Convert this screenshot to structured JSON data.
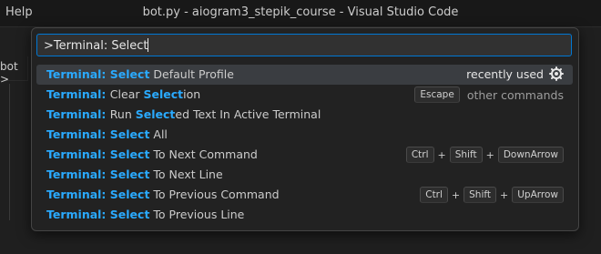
{
  "menu": {
    "help": "Help"
  },
  "window": {
    "title": "bot.py - aiogram3_stepik_course - Visual Studio Code"
  },
  "side": {
    "tab_label": "bot >"
  },
  "palette": {
    "input_value": ">Terminal: Select",
    "items": [
      {
        "hl1": "Terminal: Select",
        "rest1": " Default Profile",
        "hl2": "",
        "rest2": "",
        "badge": "recently used",
        "icon": "gear-icon"
      },
      {
        "hl1": "Terminal: ",
        "rest1": "Clear ",
        "hl2": "Select",
        "rest2": "ion",
        "key": "Escape",
        "other": "other commands"
      },
      {
        "hl1": "Terminal: ",
        "rest1": "Run ",
        "hl2": "Select",
        "rest2": "ed Text In Active Terminal"
      },
      {
        "hl1": "Terminal: Select",
        "rest1": " All"
      },
      {
        "hl1": "Terminal: Select",
        "rest1": " To Next Command",
        "keys": [
          "Ctrl",
          "Shift",
          "DownArrow"
        ]
      },
      {
        "hl1": "Terminal: Select",
        "rest1": " To Next Line"
      },
      {
        "hl1": "Terminal: Select",
        "rest1": " To Previous Command",
        "keys": [
          "Ctrl",
          "Shift",
          "UpArrow"
        ]
      },
      {
        "hl1": "Terminal: Select",
        "rest1": " To Previous Line"
      }
    ],
    "plus": "+"
  }
}
